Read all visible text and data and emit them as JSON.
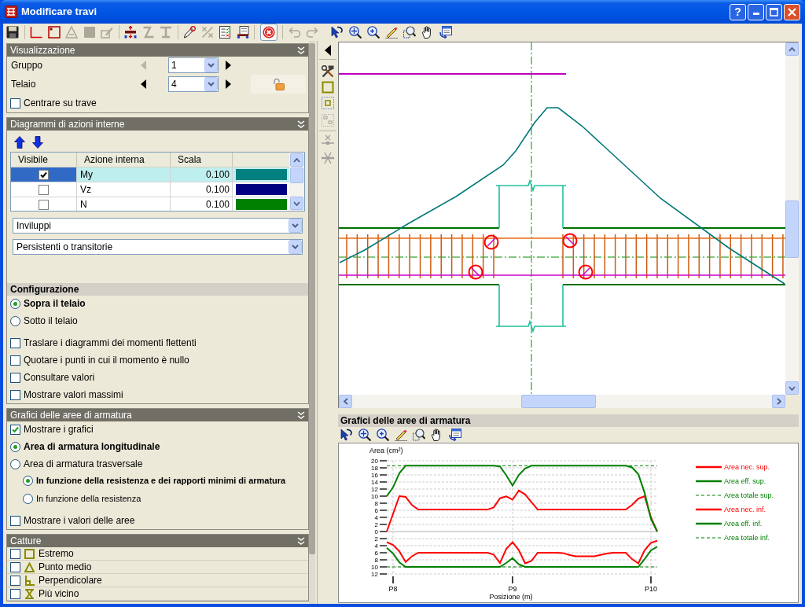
{
  "window": {
    "title": "Modificare travi",
    "help_button": "?"
  },
  "visualizzazione": {
    "title": "Visualizzazione",
    "selectors": [
      {
        "label": "Gruppo",
        "value": "1",
        "prev_disabled": true,
        "next_disabled": false
      },
      {
        "label": "Telaio",
        "value": "4",
        "prev_disabled": false,
        "next_disabled": false
      }
    ],
    "center_on_beam": {
      "label": "Centrare su trave",
      "checked": false
    }
  },
  "diagrammi": {
    "title": "Diagrammi di azioni interne",
    "table": {
      "columns": [
        "Visibile",
        "Azione interna",
        "Scala"
      ],
      "rows": [
        {
          "visible": true,
          "selected": true,
          "name": "My",
          "scale": "0.100",
          "color": "#008080"
        },
        {
          "visible": false,
          "selected": false,
          "name": "Vz",
          "scale": "0.100",
          "color": "#000080"
        },
        {
          "visible": false,
          "selected": false,
          "name": "N",
          "scale": "0.100",
          "color": "#008000"
        }
      ]
    },
    "dropdowns": [
      {
        "value": "Inviluppi"
      },
      {
        "value": "Persistenti o transitorie"
      }
    ],
    "configurazione": {
      "title": "Configurazione",
      "positions": [
        {
          "label": "Sopra il telaio",
          "selected": true
        },
        {
          "label": "Sotto il telaio",
          "selected": false
        }
      ],
      "options": [
        {
          "label": "Traslare i diagrammi dei momenti flettenti",
          "checked": false
        },
        {
          "label": "Quotare i punti in cui il momento è nullo",
          "checked": false
        },
        {
          "label": "Consultare valori",
          "checked": false
        },
        {
          "label": "Mostrare valori massimi",
          "checked": false
        }
      ]
    }
  },
  "grafici": {
    "title": "Grafici delle aree di armatura",
    "show_graphs": {
      "label": "Mostrare i grafici",
      "checked": true
    },
    "area_types": [
      {
        "label": "Area di armatura longitudinale",
        "selected": true
      },
      {
        "label": "Area di armatura trasversale",
        "selected": false,
        "children": [
          {
            "label": "In funzione della resistenza e dei rapporti minimi di armatura",
            "selected": true
          },
          {
            "label": "In funzione della resistenza",
            "selected": false
          }
        ]
      }
    ],
    "show_values": {
      "label": "Mostrare i valori delle aree",
      "checked": false
    }
  },
  "catture": {
    "title": "Catture",
    "items": [
      {
        "label": "Estremo",
        "checked": false
      },
      {
        "label": "Punto medio",
        "checked": false
      },
      {
        "label": "Perpendicolare",
        "checked": false
      },
      {
        "label": "Più vicino",
        "checked": false
      }
    ]
  },
  "area_chart_panel": {
    "title": "Grafici delle aree di armatura",
    "chart_data": {
      "type": "line",
      "xlabel": "Posizione (m)",
      "ylabel": "Area (cm²)",
      "grid": true,
      "legend": "right",
      "categories": [
        null,
        "P8",
        null,
        null,
        null,
        null,
        null,
        null,
        null,
        null,
        null,
        null,
        null,
        null,
        null,
        null,
        null,
        null,
        null,
        null,
        "P9",
        null,
        null,
        null,
        null,
        null,
        null,
        null,
        null,
        null,
        null,
        null,
        null,
        null,
        null,
        null,
        null,
        null,
        null,
        null,
        null,
        null,
        "P10",
        null
      ],
      "series": [
        {
          "name": "Area nec. sup.",
          "color": "#ff0000",
          "line_style": "solid",
          "values": [
            0,
            5,
            10,
            9.8,
            7.5,
            6.2,
            6.2,
            6.2,
            6.2,
            6.2,
            6.2,
            6.2,
            6.2,
            6.2,
            6.2,
            6.2,
            6.2,
            6.8,
            9.4,
            9.9,
            9,
            11.6,
            10.5,
            8.3,
            6.2,
            6.2,
            6.2,
            6.2,
            6.2,
            6.2,
            6.2,
            6.2,
            6.2,
            6.2,
            6.2,
            6.2,
            6.2,
            6.2,
            6.2,
            7.5,
            9.3,
            10,
            4,
            0
          ]
        },
        {
          "name": "Area eff. sup.",
          "color": "#008000",
          "line_style": "solid",
          "values": [
            10,
            12.5,
            16.5,
            18.6,
            18.6,
            18.6,
            18.6,
            18.6,
            18.6,
            18.6,
            18.6,
            18.6,
            18.6,
            18.6,
            18.6,
            18.6,
            18.6,
            18.6,
            18.4,
            15.9,
            13,
            16,
            17.8,
            18.6,
            18.6,
            18.6,
            18.6,
            18.6,
            18.6,
            18.6,
            18.6,
            18.6,
            18.6,
            18.6,
            18.6,
            18.6,
            18.6,
            18.6,
            18.6,
            18.1,
            16.2,
            10.9,
            3.6,
            0
          ]
        },
        {
          "name": "Area totale sup.",
          "color": "#008000",
          "line_style": "dashed",
          "values": [
            18.6,
            18.6,
            18.6,
            18.6,
            18.6,
            18.6,
            18.6,
            18.6,
            18.6,
            18.6,
            18.6,
            18.6,
            18.6,
            18.6,
            18.6,
            18.6,
            18.6,
            18.6,
            18.6,
            18.6,
            18.6,
            18.6,
            18.6,
            18.6,
            18.6,
            18.6,
            18.6,
            18.6,
            18.6,
            18.6,
            18.6,
            18.6,
            18.6,
            18.6,
            18.6,
            18.6,
            18.6,
            18.6,
            18.6,
            18.6,
            18.6,
            18.6,
            18.6,
            18.6
          ]
        },
        {
          "name": "Area nec. inf.",
          "color": "#ff0000",
          "line_style": "solid",
          "values": [
            -3,
            -3.8,
            -5.6,
            -8.6,
            -7,
            -6,
            -6,
            -6,
            -6,
            -6,
            -6,
            -6,
            -6,
            -6,
            -6,
            -6,
            -6,
            -6.5,
            -8.9,
            -4.9,
            -3,
            -5.3,
            -9,
            -8.3,
            -6,
            -6,
            -6,
            -6,
            -6.1,
            -6.6,
            -7,
            -7,
            -7,
            -7,
            -6.6,
            -6.2,
            -6,
            -6,
            -6,
            -7.8,
            -9,
            -5.3,
            -3.2,
            -2.6
          ]
        },
        {
          "name": "Area eff. inf.",
          "color": "#008000",
          "line_style": "solid",
          "values": [
            -4.6,
            -6.2,
            -8.7,
            -10,
            -10,
            -10,
            -10,
            -10,
            -10,
            -10,
            -10,
            -10,
            -10,
            -10,
            -10,
            -10,
            -10,
            -10,
            -10,
            -8.9,
            -7.5,
            -9.3,
            -10,
            -10,
            -10,
            -10,
            -10,
            -10,
            -10,
            -10,
            -10,
            -10,
            -10,
            -10,
            -10,
            -10,
            -10,
            -10,
            -10,
            -10,
            -10,
            -7.8,
            -5.3,
            -4.3
          ]
        },
        {
          "name": "Area totale inf.",
          "color": "#008000",
          "line_style": "dashed",
          "values": [
            -10,
            -10,
            -10,
            -10,
            -10,
            -10,
            -10,
            -10,
            -10,
            -10,
            -10,
            -10,
            -10,
            -10,
            -10,
            -10,
            -10,
            -10,
            -10,
            -10,
            -10,
            -10,
            -10,
            -10,
            -10,
            -10,
            -10,
            -10,
            -10,
            -10,
            -10,
            -10,
            -10,
            -10,
            -10,
            -10,
            -10,
            -10,
            -10,
            -10,
            -10,
            -10,
            -10,
            -10
          ]
        }
      ],
      "ylim": [
        -12,
        20
      ],
      "yticks": [
        {
          "value": -12,
          "label": "12"
        },
        {
          "value": -10,
          "label": "10"
        },
        {
          "value": -8,
          "label": "8"
        },
        {
          "value": -6,
          "label": "6"
        },
        {
          "value": -4,
          "label": "4"
        },
        {
          "value": -2,
          "label": "2"
        },
        0,
        2,
        {
          "value": 4,
          "label": "4"
        },
        6,
        8,
        10,
        12,
        14,
        16,
        18,
        20
      ]
    }
  }
}
